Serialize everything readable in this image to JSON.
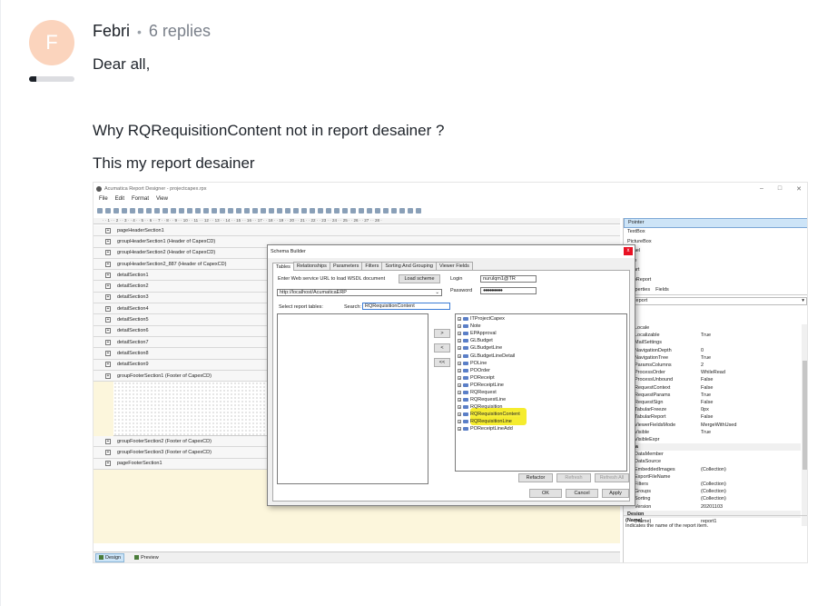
{
  "post": {
    "avatar_letter": "F",
    "avatar_color": "#fbd4bd",
    "reputation_fraction": 0.15,
    "author": "Febri",
    "separator": "•",
    "replies": "6 replies",
    "paragraphs": [
      "Dear all,",
      "Why RQRequisitionContent not in report desainer ?",
      "This my report desainer"
    ]
  },
  "screenshot": {
    "window_title": "Acumatica Report Designer - projectcapex.rpx",
    "window_controls": [
      "–",
      "□",
      "✕"
    ],
    "menu": [
      "File",
      "Edit",
      "Format",
      "View"
    ],
    "ruler_text": "·  ·  1  ·  ·  2  ·  ·  3  ·  ·  4  ·  ·  5  ·  ·  6  ·  ·  7  ·  ·  8  ·  ·  9  ·  ·  10  ·  ·  11  ·  ·  12  ·  ·  13  ·  ·  14  ·  ·  15  ·  ·  16  ·  ·  17  ·  ·  18  ·  ·  19  ·  ·  20  ·  ·  21  ·  ·  22  ·  ·  23  ·  ·  24  ·  ·  25  ·  ·  26  ·  ·  27  ·  ·  28  ·",
    "sections_top": [
      "pageHeaderSection1",
      "groupHeaderSection1 (Header of CapexCD)",
      "groupHeaderSection2 (Header of CapexCD)",
      "groupHeaderSection2_887 (Header of CapexCD)",
      "detailSection1",
      "detailSection2",
      "detailSection3",
      "detailSection4",
      "detailSection5",
      "detailSection6",
      "detailSection7",
      "detailSection8",
      "detailSection9",
      "groupFooterSection1 (Footer of CapexCD)"
    ],
    "sections_bottom": [
      "groupFooterSection2 (Footer of CapexCD)",
      "groupFooterSection3 (Footer of CapexCD)",
      "pageFooterSection1"
    ],
    "status_tabs": [
      "Design",
      "Preview"
    ],
    "toolbox": [
      "Pointer",
      "TextBox",
      "PictureBox",
      "Panel",
      "Line",
      "Chart",
      "SubReport"
    ],
    "prop_tabs": [
      "Properties",
      "Fields"
    ],
    "prop_object": "1 Report",
    "properties": [
      {
        "k": "Locale",
        "v": ""
      },
      {
        "k": "Localizable",
        "v": "True"
      },
      {
        "k": "MailSettings",
        "v": ""
      },
      {
        "k": "NavigationDepth",
        "v": "0"
      },
      {
        "k": "NavigationTree",
        "v": "True"
      },
      {
        "k": "ParamsColumns",
        "v": "2"
      },
      {
        "k": "ProcessOrder",
        "v": "WhileRead"
      },
      {
        "k": "ProcessUnbound",
        "v": "False"
      },
      {
        "k": "RequestContext",
        "v": "False"
      },
      {
        "k": "RequestParams",
        "v": "True"
      },
      {
        "k": "RequestSign",
        "v": "False"
      },
      {
        "k": "TabularFreeze",
        "v": "0px"
      },
      {
        "k": "TabularReport",
        "v": "False"
      },
      {
        "k": "ViewerFieldsMode",
        "v": "MergeWithUsed"
      },
      {
        "k": "Visible",
        "v": "True"
      },
      {
        "k": "VisibleExpr",
        "v": ""
      },
      {
        "k": "Data",
        "v": "",
        "cat": true
      },
      {
        "k": "DataMember",
        "v": ""
      },
      {
        "k": "DataSource",
        "v": ""
      },
      {
        "k": "EmbeddedImages",
        "v": "(Collection)"
      },
      {
        "k": "ExportFileName",
        "v": ""
      },
      {
        "k": "Filters",
        "v": "(Collection)"
      },
      {
        "k": "Groups",
        "v": "(Collection)"
      },
      {
        "k": "Sorting",
        "v": "(Collection)"
      },
      {
        "k": "Version",
        "v": "20201103"
      },
      {
        "k": "Design",
        "v": "",
        "cat": true
      },
      {
        "k": "(Name)",
        "v": "report1"
      }
    ],
    "prop_desc_title": "(Name)",
    "prop_desc_text": "Indicates the name of the report item.",
    "dialog": {
      "title": "Schema Builder",
      "close": "x",
      "tabs": [
        "Tables",
        "Relationships",
        "Parameters",
        "Filters",
        "Sorting And Grouping",
        "Viewer Fields"
      ],
      "url_label": "Enter Web service URL to load WSDL document",
      "load_button": "Load scheme",
      "url_value": "http://localhost/AcumaticaERP",
      "login_label": "Login",
      "login_value": "nurulqm1@TR",
      "password_label": "Password",
      "password_value": "●●●●●●●●●",
      "select_label": "Select report tables:",
      "search_label": "Search:",
      "search_value": "RQRequisitionContent",
      "move_buttons": [
        ">",
        "<",
        "<<"
      ],
      "tree": [
        "ITProjectCapex",
        "Note",
        "EPApproval",
        "GLBudget",
        "GLBudgetLine",
        "GLBudgetLineDetail",
        "POLine",
        "POOrder",
        "POReceipt",
        "POReceiptLine",
        "RQRequest",
        "RQRequestLine",
        "RQRequisition",
        "RQRequisitionContent",
        "RQRequisitionLine",
        "POReceiptLineAdd"
      ],
      "highlighted": "RQRequisitionContent",
      "highlight_color": "#f5ec2e",
      "refactor": "Refactor",
      "refresh": "Refresh",
      "refresh_all": "Refresh All",
      "ok": "OK",
      "cancel": "Cancel",
      "apply": "Apply"
    }
  }
}
